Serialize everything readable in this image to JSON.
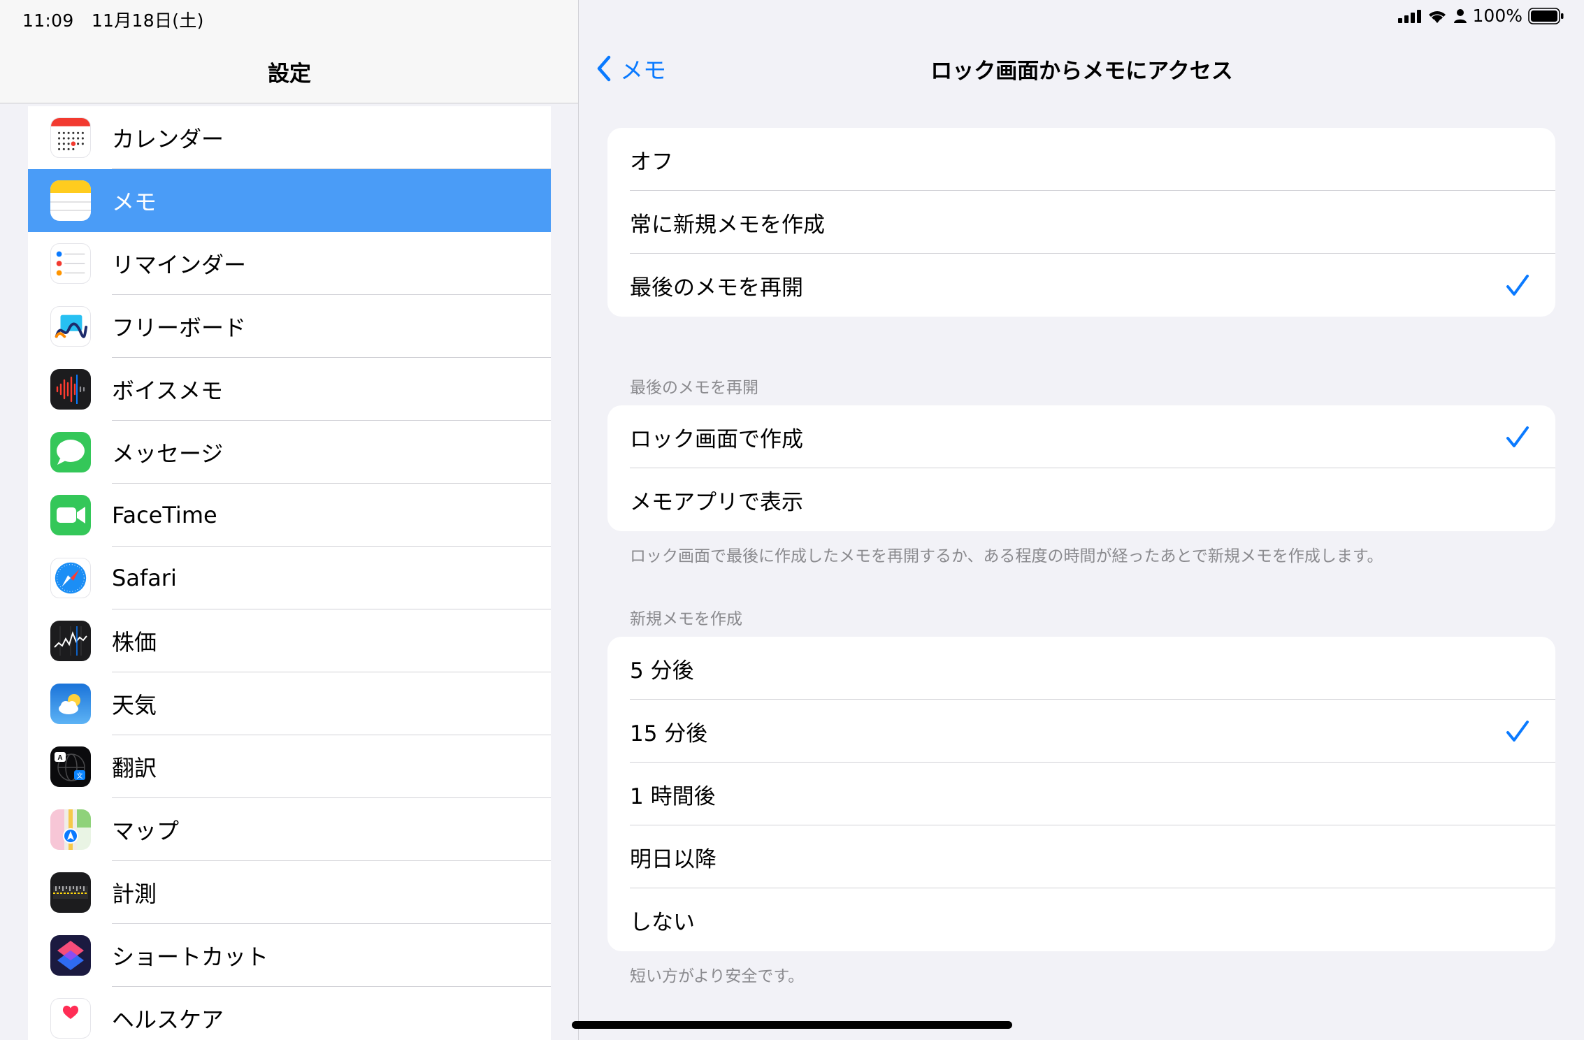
{
  "status": {
    "time_date": "11:09　11月18日(土)",
    "battery": "100%"
  },
  "sidebar": {
    "title": "設定",
    "items": [
      {
        "label": "カレンダー",
        "icon": "calendar-icon"
      },
      {
        "label": "メモ",
        "icon": "notes-icon",
        "selected": true
      },
      {
        "label": "リマインダー",
        "icon": "reminders-icon"
      },
      {
        "label": "フリーボード",
        "icon": "freeform-icon"
      },
      {
        "label": "ボイスメモ",
        "icon": "voice-memos-icon"
      },
      {
        "label": "メッセージ",
        "icon": "messages-icon"
      },
      {
        "label": "FaceTime",
        "icon": "facetime-icon"
      },
      {
        "label": "Safari",
        "icon": "safari-icon"
      },
      {
        "label": "株価",
        "icon": "stocks-icon"
      },
      {
        "label": "天気",
        "icon": "weather-icon"
      },
      {
        "label": "翻訳",
        "icon": "translate-icon"
      },
      {
        "label": "マップ",
        "icon": "maps-icon"
      },
      {
        "label": "計測",
        "icon": "measure-icon"
      },
      {
        "label": "ショートカット",
        "icon": "shortcuts-icon"
      },
      {
        "label": "ヘルスケア",
        "icon": "health-icon"
      }
    ]
  },
  "detail": {
    "back_label": "メモ",
    "title": "ロック画面からメモにアクセス",
    "group1": [
      {
        "label": "オフ",
        "checked": false
      },
      {
        "label": "常に新規メモを作成",
        "checked": false
      },
      {
        "label": "最後のメモを再開",
        "checked": true
      }
    ],
    "group2_header": "最後のメモを再開",
    "group2": [
      {
        "label": "ロック画面で作成",
        "checked": true
      },
      {
        "label": "メモアプリで表示",
        "checked": false
      }
    ],
    "group2_footer": "ロック画面で最後に作成したメモを再開するか、ある程度の時間が経ったあとで新規メモを作成します。",
    "group3_header": "新規メモを作成",
    "group3": [
      {
        "label": "5 分後",
        "checked": false
      },
      {
        "label": "15 分後",
        "checked": true
      },
      {
        "label": "1 時間後",
        "checked": false
      },
      {
        "label": "明日以降",
        "checked": false
      },
      {
        "label": "しない",
        "checked": false
      }
    ],
    "group3_footer": "短い方がより安全です。"
  },
  "colors": {
    "accent": "#0a7aff",
    "selected_row": "#4a9cf7"
  }
}
